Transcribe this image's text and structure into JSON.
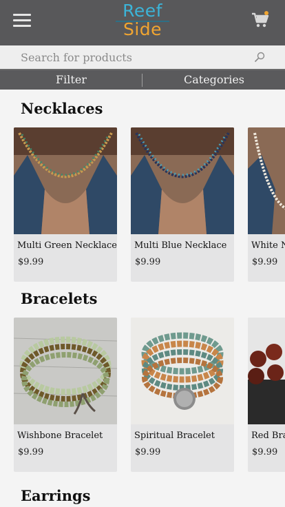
{
  "header": {
    "logo_line1": "Reef",
    "logo_line2": "Side"
  },
  "search": {
    "placeholder": "Search for products"
  },
  "filterbar": {
    "filter_label": "Filter",
    "categories_label": "Categories"
  },
  "sections": [
    {
      "title": "Necklaces",
      "products": [
        {
          "name": "Multi Green Necklace",
          "price": "$9.99"
        },
        {
          "name": "Multi Blue Necklace",
          "price": "$9.99"
        },
        {
          "name": "White Necklace",
          "price": "$9.99"
        }
      ]
    },
    {
      "title": "Bracelets",
      "products": [
        {
          "name": "Wishbone Bracelet",
          "price": "$9.99"
        },
        {
          "name": "Spiritual Bracelet",
          "price": "$9.99"
        },
        {
          "name": "Red Bracelet",
          "price": "$9.99"
        }
      ]
    },
    {
      "title": "Earrings"
    }
  ],
  "colors": {
    "header_bg": "#58585a",
    "logo_blue": "#3cb4d8",
    "logo_orange": "#f0a531",
    "card_bg": "#e4e4e5"
  }
}
